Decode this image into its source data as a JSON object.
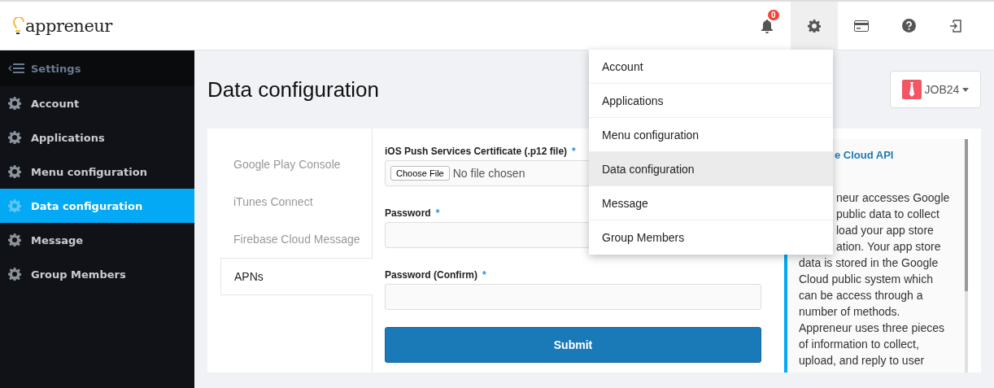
{
  "header": {
    "logo": "appreneur",
    "notification_count": "0",
    "icons": [
      {
        "kind": "bell",
        "selected": false
      },
      {
        "kind": "gear",
        "selected": true
      },
      {
        "kind": "card",
        "selected": false
      },
      {
        "kind": "help",
        "selected": false
      },
      {
        "kind": "logout",
        "selected": false
      }
    ]
  },
  "sidebar": {
    "title": "Settings",
    "items": [
      {
        "label": "Account",
        "selected": false
      },
      {
        "label": "Applications",
        "selected": false
      },
      {
        "label": "Menu configuration",
        "selected": false
      },
      {
        "label": "Data configuration",
        "selected": true
      },
      {
        "label": "Message",
        "selected": false
      },
      {
        "label": "Group Members",
        "selected": false
      }
    ]
  },
  "page_title": "Data configuration",
  "org_button": "JOB24",
  "tabs": [
    {
      "label": "Google Play Console",
      "selected": false
    },
    {
      "label": "iTunes Connect",
      "selected": false
    },
    {
      "label": "Firebase Cloud Message",
      "selected": false
    },
    {
      "label": "APNs",
      "selected": true
    }
  ],
  "form": {
    "fields": [
      {
        "kind": "file",
        "label": "iOS Push Services Certificate (.p12 file)",
        "required_mark": "*",
        "button": "Choose File",
        "value": "No file chosen"
      },
      {
        "kind": "password",
        "label": "Password",
        "required_mark": "*"
      },
      {
        "kind": "password",
        "label": "Password (Confirm)",
        "required_mark": "*"
      }
    ],
    "submit": "Submit"
  },
  "info_panel": {
    "title": "e Cloud API",
    "lines": [
      {
        "text": "neur accesses Google",
        "clipped": true
      },
      {
        "text": "public data to collect",
        "clipped": true
      },
      {
        "text": "load your app store",
        "clipped": true
      },
      {
        "text": "ation.  Your app store",
        "clipped": true
      },
      {
        "text": "data is stored in the Google",
        "clipped": false
      },
      {
        "text": "Cloud public system which",
        "clipped": false
      },
      {
        "text": "can be access through a",
        "clipped": false
      },
      {
        "text": "number of methods.",
        "clipped": false
      },
      {
        "text": "Appreneur uses three pieces",
        "clipped": false
      },
      {
        "text": "of information to collect,",
        "clipped": false
      },
      {
        "text": "upload, and reply to user",
        "clipped": false
      }
    ]
  },
  "settings_menu": {
    "items": [
      {
        "label": "Account",
        "selected": false
      },
      {
        "label": "Applications",
        "selected": false
      },
      {
        "label": "Menu configuration",
        "selected": false
      },
      {
        "label": "Data configuration",
        "selected": true
      },
      {
        "label": "Message",
        "selected": false
      },
      {
        "label": "Group Members",
        "selected": false
      }
    ]
  }
}
